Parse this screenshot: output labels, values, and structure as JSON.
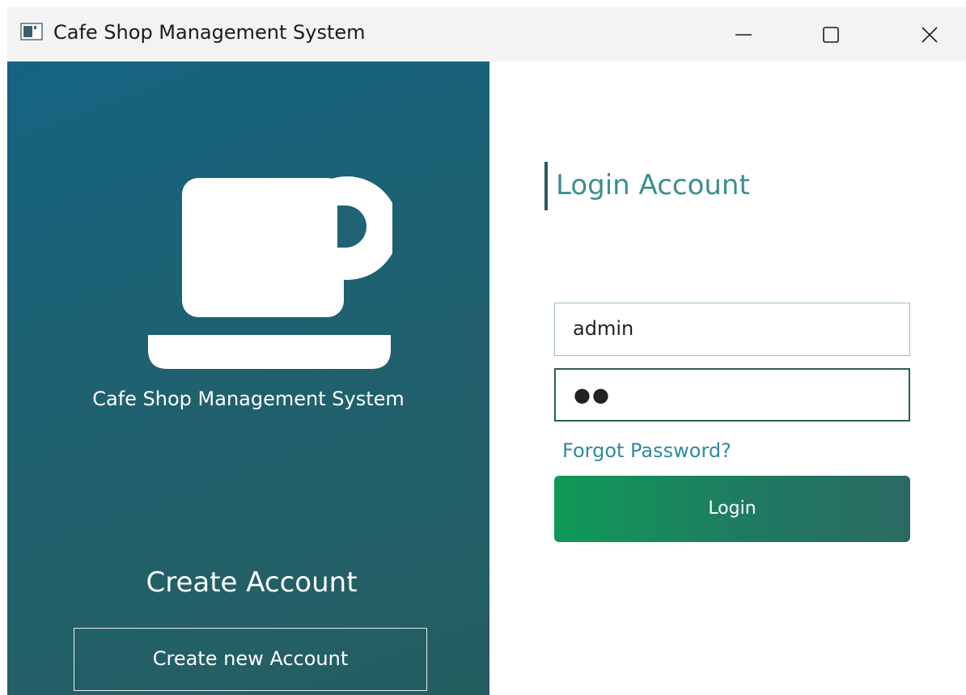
{
  "window": {
    "title": "Cafe Shop Management System",
    "controls": {
      "minimize": "minimize-icon",
      "maximize": "maximize-icon",
      "close": "close-icon"
    }
  },
  "left_panel": {
    "icon": "coffee-cup-icon",
    "brand_text": "Cafe Shop Management System",
    "create_heading": "Create Account",
    "create_button_label": "Create new Account",
    "gradient": [
      "#146482",
      "#255e60"
    ]
  },
  "login": {
    "heading": "Login Account",
    "username_value": "admin",
    "password_value": "●●",
    "forgot_label": "Forgot Password?",
    "login_label": "Login",
    "accent_color": "#3b8f8f",
    "button_gradient": [
      "#109a57",
      "#2b6a63"
    ]
  }
}
